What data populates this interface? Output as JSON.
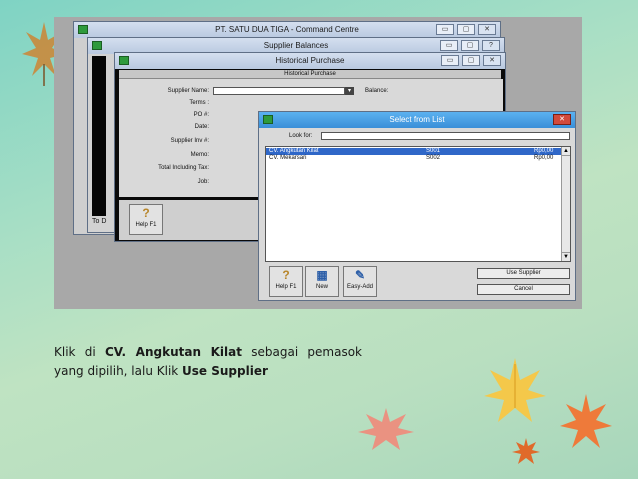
{
  "colors": {
    "selection": "#2f67c8",
    "active_titlebar": "#3a8fd8"
  },
  "command_centre": {
    "title": "PT. SATU DUA TIGA - Command Centre"
  },
  "supplier_balances": {
    "title": "Supplier Balances",
    "bottom_text": "To D"
  },
  "historical_purchase": {
    "title": "Historical Purchase",
    "subheader": "Historical Purchase",
    "labels": {
      "supplier_name": "Supplier Name:",
      "terms": "Terms :",
      "po": "PO #:",
      "date": "Date:",
      "supplier_inv": "Supplier Inv #:",
      "memo": "Memo:",
      "total": "Total Including Tax:",
      "job": "Job:",
      "balance": "Balance:"
    },
    "help_button": "Help F1"
  },
  "select_from_list": {
    "title": "Select from List",
    "look_for_label": "Look for:",
    "rows": [
      {
        "name": "CV. Angkutan Kilat",
        "code": "S001",
        "amount": "Rp0,00",
        "selected": true
      },
      {
        "name": "CV. Mekarsari",
        "code": "S002",
        "amount": "Rp0,00",
        "selected": false
      }
    ],
    "buttons": {
      "help": "Help F1",
      "new": "New",
      "easy_add": "Easy-Add"
    },
    "use_supplier": "Use Supplier",
    "cancel": "Cancel"
  },
  "caption": {
    "part1": "Klik di ",
    "bold1": "CV. Angkutan Kilat",
    "part2": " sebagai pemasok yang dipilih, lalu Klik ",
    "bold2": "Use Supplier"
  }
}
